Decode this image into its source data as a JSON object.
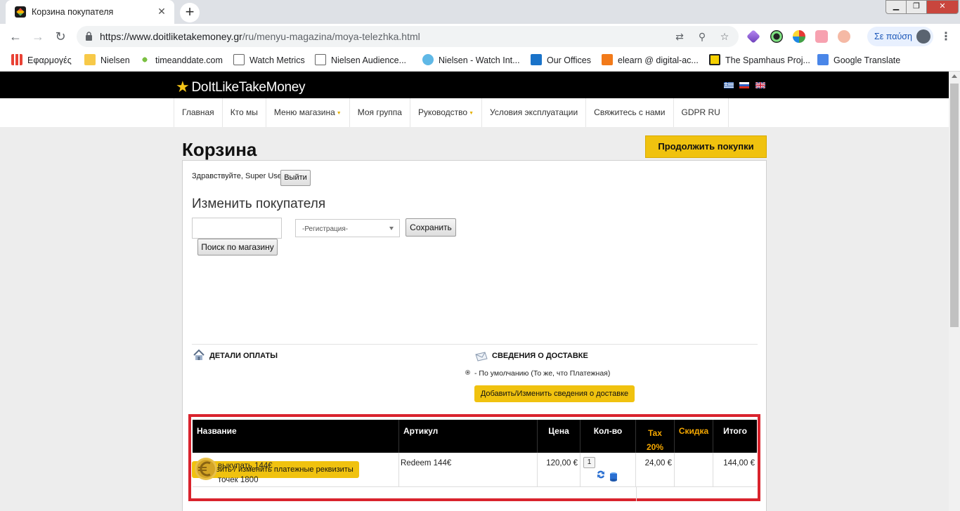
{
  "browser": {
    "tab_title": "Корзина покупателя",
    "url_host": "https://www.doitliketakemoney.gr",
    "url_path": "/ru/menyu-magazina/moya-telezhka.html",
    "profile_label": "Σε παύση",
    "bookmarks": [
      "Εφαρμογές",
      "Nielsen",
      "timeanddate.com",
      "Watch Metrics",
      "Nielsen Audience...",
      "Nielsen - Watch Int...",
      "Our Offices",
      "elearn @ digital-ac...",
      "The Spamhaus Proj...",
      "Google Translate"
    ]
  },
  "site": {
    "logo": "DoItLikeTakeMoney",
    "nav": [
      "Главная",
      "Кто мы",
      "Меню магазина",
      "Моя группа",
      "Руководство",
      "Условия эксплуатации",
      "Свяжитесь с нами",
      "GDPR RU"
    ]
  },
  "cart": {
    "title": "Корзина",
    "continue_label": "Продолжить покупки",
    "greeting": "Здравствуйте, Super User",
    "logout_label": "Выйти",
    "change_buyer": "Изменить покупателя",
    "select_placeholder": "-Регистрация-",
    "save_label": "Сохранить",
    "search_label": "Поиск по магазину",
    "billing_heading": "ДЕТАЛИ ОПЛАТЫ",
    "shipping_heading": "СВЕДЕНИЯ О ДОСТАВКЕ",
    "shipping_default": "- По умолчанию (То же, что Платежная)",
    "shipping_button": "Добавить/Изменить сведения о доставке",
    "billing_button": "Добавить / изменить платежные реквизиты"
  },
  "table": {
    "headers": {
      "name": "Название",
      "sku": "Артикул",
      "price": "Цена",
      "qty": "Кол-во",
      "tax_line1": "Tax",
      "tax_line2": "20%",
      "discount": "Скидка",
      "total": "Итого"
    },
    "row": {
      "name_line1": "выкупать 144€",
      "name_line2": "точек 1800",
      "sku": "Redeem 144€",
      "price": "120,00 €",
      "qty": "1",
      "tax": "24,00 €",
      "discount": "",
      "total": "144,00 €"
    }
  },
  "colors": {
    "accent": "#f0c20f",
    "header_bg": "#000000",
    "highlight": "#d9232d",
    "gold_text": "#f5a700"
  }
}
